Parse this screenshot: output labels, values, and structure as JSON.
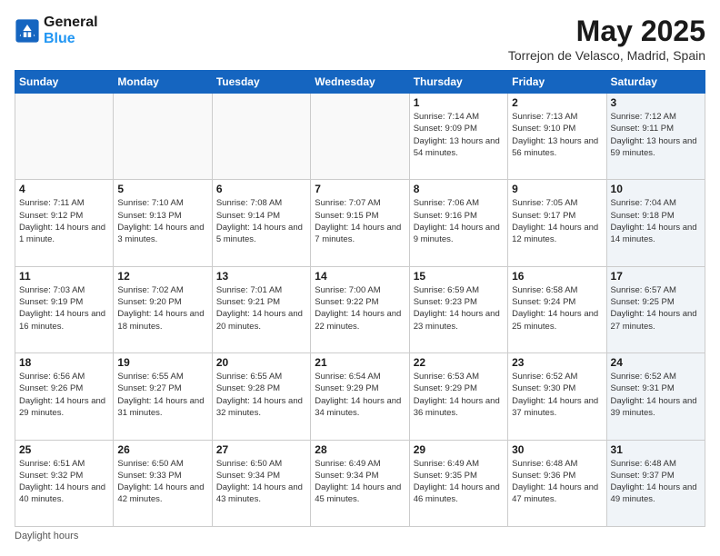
{
  "logo": {
    "line1": "General",
    "line2": "Blue"
  },
  "title": "May 2025",
  "subtitle": "Torrejon de Velasco, Madrid, Spain",
  "days_of_week": [
    "Sunday",
    "Monday",
    "Tuesday",
    "Wednesday",
    "Thursday",
    "Friday",
    "Saturday"
  ],
  "footer": "Daylight hours",
  "weeks": [
    [
      {
        "day": "",
        "info": ""
      },
      {
        "day": "",
        "info": ""
      },
      {
        "day": "",
        "info": ""
      },
      {
        "day": "",
        "info": ""
      },
      {
        "day": "1",
        "info": "Sunrise: 7:14 AM\nSunset: 9:09 PM\nDaylight: 13 hours\nand 54 minutes."
      },
      {
        "day": "2",
        "info": "Sunrise: 7:13 AM\nSunset: 9:10 PM\nDaylight: 13 hours\nand 56 minutes."
      },
      {
        "day": "3",
        "info": "Sunrise: 7:12 AM\nSunset: 9:11 PM\nDaylight: 13 hours\nand 59 minutes."
      }
    ],
    [
      {
        "day": "4",
        "info": "Sunrise: 7:11 AM\nSunset: 9:12 PM\nDaylight: 14 hours\nand 1 minute."
      },
      {
        "day": "5",
        "info": "Sunrise: 7:10 AM\nSunset: 9:13 PM\nDaylight: 14 hours\nand 3 minutes."
      },
      {
        "day": "6",
        "info": "Sunrise: 7:08 AM\nSunset: 9:14 PM\nDaylight: 14 hours\nand 5 minutes."
      },
      {
        "day": "7",
        "info": "Sunrise: 7:07 AM\nSunset: 9:15 PM\nDaylight: 14 hours\nand 7 minutes."
      },
      {
        "day": "8",
        "info": "Sunrise: 7:06 AM\nSunset: 9:16 PM\nDaylight: 14 hours\nand 9 minutes."
      },
      {
        "day": "9",
        "info": "Sunrise: 7:05 AM\nSunset: 9:17 PM\nDaylight: 14 hours\nand 12 minutes."
      },
      {
        "day": "10",
        "info": "Sunrise: 7:04 AM\nSunset: 9:18 PM\nDaylight: 14 hours\nand 14 minutes."
      }
    ],
    [
      {
        "day": "11",
        "info": "Sunrise: 7:03 AM\nSunset: 9:19 PM\nDaylight: 14 hours\nand 16 minutes."
      },
      {
        "day": "12",
        "info": "Sunrise: 7:02 AM\nSunset: 9:20 PM\nDaylight: 14 hours\nand 18 minutes."
      },
      {
        "day": "13",
        "info": "Sunrise: 7:01 AM\nSunset: 9:21 PM\nDaylight: 14 hours\nand 20 minutes."
      },
      {
        "day": "14",
        "info": "Sunrise: 7:00 AM\nSunset: 9:22 PM\nDaylight: 14 hours\nand 22 minutes."
      },
      {
        "day": "15",
        "info": "Sunrise: 6:59 AM\nSunset: 9:23 PM\nDaylight: 14 hours\nand 23 minutes."
      },
      {
        "day": "16",
        "info": "Sunrise: 6:58 AM\nSunset: 9:24 PM\nDaylight: 14 hours\nand 25 minutes."
      },
      {
        "day": "17",
        "info": "Sunrise: 6:57 AM\nSunset: 9:25 PM\nDaylight: 14 hours\nand 27 minutes."
      }
    ],
    [
      {
        "day": "18",
        "info": "Sunrise: 6:56 AM\nSunset: 9:26 PM\nDaylight: 14 hours\nand 29 minutes."
      },
      {
        "day": "19",
        "info": "Sunrise: 6:55 AM\nSunset: 9:27 PM\nDaylight: 14 hours\nand 31 minutes."
      },
      {
        "day": "20",
        "info": "Sunrise: 6:55 AM\nSunset: 9:28 PM\nDaylight: 14 hours\nand 32 minutes."
      },
      {
        "day": "21",
        "info": "Sunrise: 6:54 AM\nSunset: 9:29 PM\nDaylight: 14 hours\nand 34 minutes."
      },
      {
        "day": "22",
        "info": "Sunrise: 6:53 AM\nSunset: 9:29 PM\nDaylight: 14 hours\nand 36 minutes."
      },
      {
        "day": "23",
        "info": "Sunrise: 6:52 AM\nSunset: 9:30 PM\nDaylight: 14 hours\nand 37 minutes."
      },
      {
        "day": "24",
        "info": "Sunrise: 6:52 AM\nSunset: 9:31 PM\nDaylight: 14 hours\nand 39 minutes."
      }
    ],
    [
      {
        "day": "25",
        "info": "Sunrise: 6:51 AM\nSunset: 9:32 PM\nDaylight: 14 hours\nand 40 minutes."
      },
      {
        "day": "26",
        "info": "Sunrise: 6:50 AM\nSunset: 9:33 PM\nDaylight: 14 hours\nand 42 minutes."
      },
      {
        "day": "27",
        "info": "Sunrise: 6:50 AM\nSunset: 9:34 PM\nDaylight: 14 hours\nand 43 minutes."
      },
      {
        "day": "28",
        "info": "Sunrise: 6:49 AM\nSunset: 9:34 PM\nDaylight: 14 hours\nand 45 minutes."
      },
      {
        "day": "29",
        "info": "Sunrise: 6:49 AM\nSunset: 9:35 PM\nDaylight: 14 hours\nand 46 minutes."
      },
      {
        "day": "30",
        "info": "Sunrise: 6:48 AM\nSunset: 9:36 PM\nDaylight: 14 hours\nand 47 minutes."
      },
      {
        "day": "31",
        "info": "Sunrise: 6:48 AM\nSunset: 9:37 PM\nDaylight: 14 hours\nand 49 minutes."
      }
    ]
  ]
}
